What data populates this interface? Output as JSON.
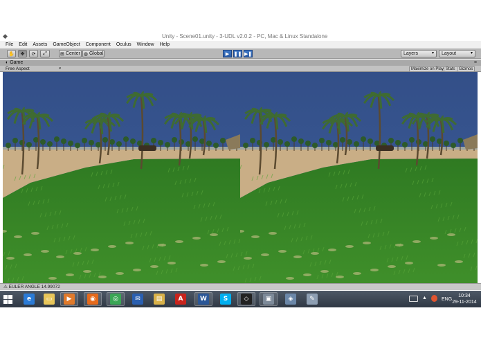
{
  "window": {
    "title": "Unity - Scene01.unity - 3-UDL v2.0.2 - PC, Mac & Linux Standalone"
  },
  "menu": [
    "File",
    "Edit",
    "Assets",
    "GameObject",
    "Component",
    "Oculus",
    "Window",
    "Help"
  ],
  "toolbar": {
    "transform_tools": [
      "hand-icon",
      "move-icon",
      "rotate-icon",
      "scale-icon"
    ],
    "pivot_label": "Center",
    "space_label": "Global",
    "play_controls": [
      "play-icon",
      "pause-icon",
      "step-icon"
    ],
    "layers_label": "Layers",
    "layout_label": "Layout"
  },
  "game_panel": {
    "tab_label": "Game",
    "aspect_label": "Free Aspect",
    "maximize_label": "Maximize on Play",
    "stats_label": "Stats",
    "gizmos_label": "Gizmos"
  },
  "statusbar": {
    "message": "EULER ANGLE 14.99072"
  },
  "taskbar": {
    "apps": [
      {
        "name": "Internet Explorer",
        "icon": "ie-icon",
        "color": "#2b7bd6"
      },
      {
        "name": "File Explorer",
        "icon": "folder-icon",
        "color": "#e8c65a"
      },
      {
        "name": "Media Player",
        "icon": "media-icon",
        "color": "#e07a2b"
      },
      {
        "name": "Firefox",
        "icon": "firefox-icon",
        "color": "#e56a1c"
      },
      {
        "name": "Chrome",
        "icon": "chrome-icon",
        "color": "#3aa655"
      },
      {
        "name": "Mail",
        "icon": "mail-icon",
        "color": "#2a5fb0"
      },
      {
        "name": "Files",
        "icon": "files-icon",
        "color": "#d9b24a"
      },
      {
        "name": "Adobe Reader",
        "icon": "pdf-icon",
        "color": "#c8231c"
      },
      {
        "name": "Word",
        "icon": "word-icon",
        "color": "#2b5797"
      },
      {
        "name": "Skype",
        "icon": "skype-icon",
        "color": "#00aff0"
      },
      {
        "name": "Unity",
        "icon": "unity-icon",
        "color": "#222222"
      },
      {
        "name": "Remote",
        "icon": "remote-icon",
        "color": "#7d8a99"
      },
      {
        "name": "Network",
        "icon": "network-icon",
        "color": "#6b87a8"
      },
      {
        "name": "Tool",
        "icon": "tool-icon",
        "color": "#8e9fb3"
      }
    ],
    "language": "ENG",
    "time": "10:34",
    "date": "29-11-2014"
  },
  "colors": {
    "sky": "#334f88",
    "grass": "#3f8f2a",
    "sand": "#c9ae86",
    "taskbar": "#3a4452"
  }
}
